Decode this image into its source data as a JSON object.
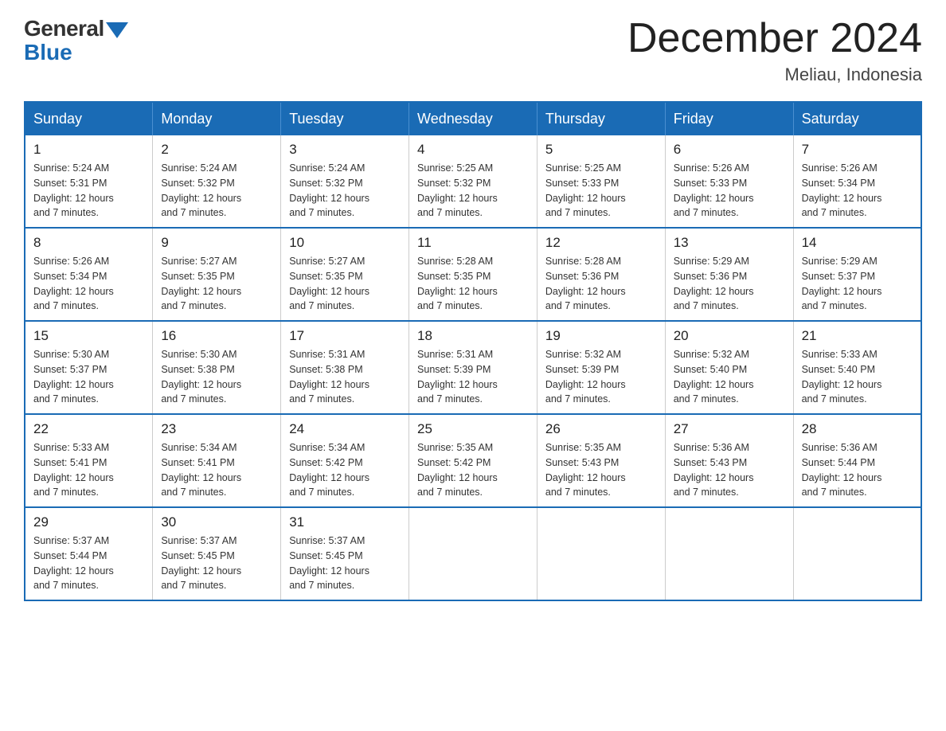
{
  "header": {
    "logo_general": "General",
    "logo_blue": "Blue",
    "title": "December 2024",
    "location": "Meliau, Indonesia"
  },
  "days_of_week": [
    "Sunday",
    "Monday",
    "Tuesday",
    "Wednesday",
    "Thursday",
    "Friday",
    "Saturday"
  ],
  "weeks": [
    [
      {
        "day": "1",
        "sunrise": "5:24 AM",
        "sunset": "5:31 PM",
        "daylight": "12 hours and 7 minutes."
      },
      {
        "day": "2",
        "sunrise": "5:24 AM",
        "sunset": "5:32 PM",
        "daylight": "12 hours and 7 minutes."
      },
      {
        "day": "3",
        "sunrise": "5:24 AM",
        "sunset": "5:32 PM",
        "daylight": "12 hours and 7 minutes."
      },
      {
        "day": "4",
        "sunrise": "5:25 AM",
        "sunset": "5:32 PM",
        "daylight": "12 hours and 7 minutes."
      },
      {
        "day": "5",
        "sunrise": "5:25 AM",
        "sunset": "5:33 PM",
        "daylight": "12 hours and 7 minutes."
      },
      {
        "day": "6",
        "sunrise": "5:26 AM",
        "sunset": "5:33 PM",
        "daylight": "12 hours and 7 minutes."
      },
      {
        "day": "7",
        "sunrise": "5:26 AM",
        "sunset": "5:34 PM",
        "daylight": "12 hours and 7 minutes."
      }
    ],
    [
      {
        "day": "8",
        "sunrise": "5:26 AM",
        "sunset": "5:34 PM",
        "daylight": "12 hours and 7 minutes."
      },
      {
        "day": "9",
        "sunrise": "5:27 AM",
        "sunset": "5:35 PM",
        "daylight": "12 hours and 7 minutes."
      },
      {
        "day": "10",
        "sunrise": "5:27 AM",
        "sunset": "5:35 PM",
        "daylight": "12 hours and 7 minutes."
      },
      {
        "day": "11",
        "sunrise": "5:28 AM",
        "sunset": "5:35 PM",
        "daylight": "12 hours and 7 minutes."
      },
      {
        "day": "12",
        "sunrise": "5:28 AM",
        "sunset": "5:36 PM",
        "daylight": "12 hours and 7 minutes."
      },
      {
        "day": "13",
        "sunrise": "5:29 AM",
        "sunset": "5:36 PM",
        "daylight": "12 hours and 7 minutes."
      },
      {
        "day": "14",
        "sunrise": "5:29 AM",
        "sunset": "5:37 PM",
        "daylight": "12 hours and 7 minutes."
      }
    ],
    [
      {
        "day": "15",
        "sunrise": "5:30 AM",
        "sunset": "5:37 PM",
        "daylight": "12 hours and 7 minutes."
      },
      {
        "day": "16",
        "sunrise": "5:30 AM",
        "sunset": "5:38 PM",
        "daylight": "12 hours and 7 minutes."
      },
      {
        "day": "17",
        "sunrise": "5:31 AM",
        "sunset": "5:38 PM",
        "daylight": "12 hours and 7 minutes."
      },
      {
        "day": "18",
        "sunrise": "5:31 AM",
        "sunset": "5:39 PM",
        "daylight": "12 hours and 7 minutes."
      },
      {
        "day": "19",
        "sunrise": "5:32 AM",
        "sunset": "5:39 PM",
        "daylight": "12 hours and 7 minutes."
      },
      {
        "day": "20",
        "sunrise": "5:32 AM",
        "sunset": "5:40 PM",
        "daylight": "12 hours and 7 minutes."
      },
      {
        "day": "21",
        "sunrise": "5:33 AM",
        "sunset": "5:40 PM",
        "daylight": "12 hours and 7 minutes."
      }
    ],
    [
      {
        "day": "22",
        "sunrise": "5:33 AM",
        "sunset": "5:41 PM",
        "daylight": "12 hours and 7 minutes."
      },
      {
        "day": "23",
        "sunrise": "5:34 AM",
        "sunset": "5:41 PM",
        "daylight": "12 hours and 7 minutes."
      },
      {
        "day": "24",
        "sunrise": "5:34 AM",
        "sunset": "5:42 PM",
        "daylight": "12 hours and 7 minutes."
      },
      {
        "day": "25",
        "sunrise": "5:35 AM",
        "sunset": "5:42 PM",
        "daylight": "12 hours and 7 minutes."
      },
      {
        "day": "26",
        "sunrise": "5:35 AM",
        "sunset": "5:43 PM",
        "daylight": "12 hours and 7 minutes."
      },
      {
        "day": "27",
        "sunrise": "5:36 AM",
        "sunset": "5:43 PM",
        "daylight": "12 hours and 7 minutes."
      },
      {
        "day": "28",
        "sunrise": "5:36 AM",
        "sunset": "5:44 PM",
        "daylight": "12 hours and 7 minutes."
      }
    ],
    [
      {
        "day": "29",
        "sunrise": "5:37 AM",
        "sunset": "5:44 PM",
        "daylight": "12 hours and 7 minutes."
      },
      {
        "day": "30",
        "sunrise": "5:37 AM",
        "sunset": "5:45 PM",
        "daylight": "12 hours and 7 minutes."
      },
      {
        "day": "31",
        "sunrise": "5:37 AM",
        "sunset": "5:45 PM",
        "daylight": "12 hours and 7 minutes."
      },
      null,
      null,
      null,
      null
    ]
  ]
}
